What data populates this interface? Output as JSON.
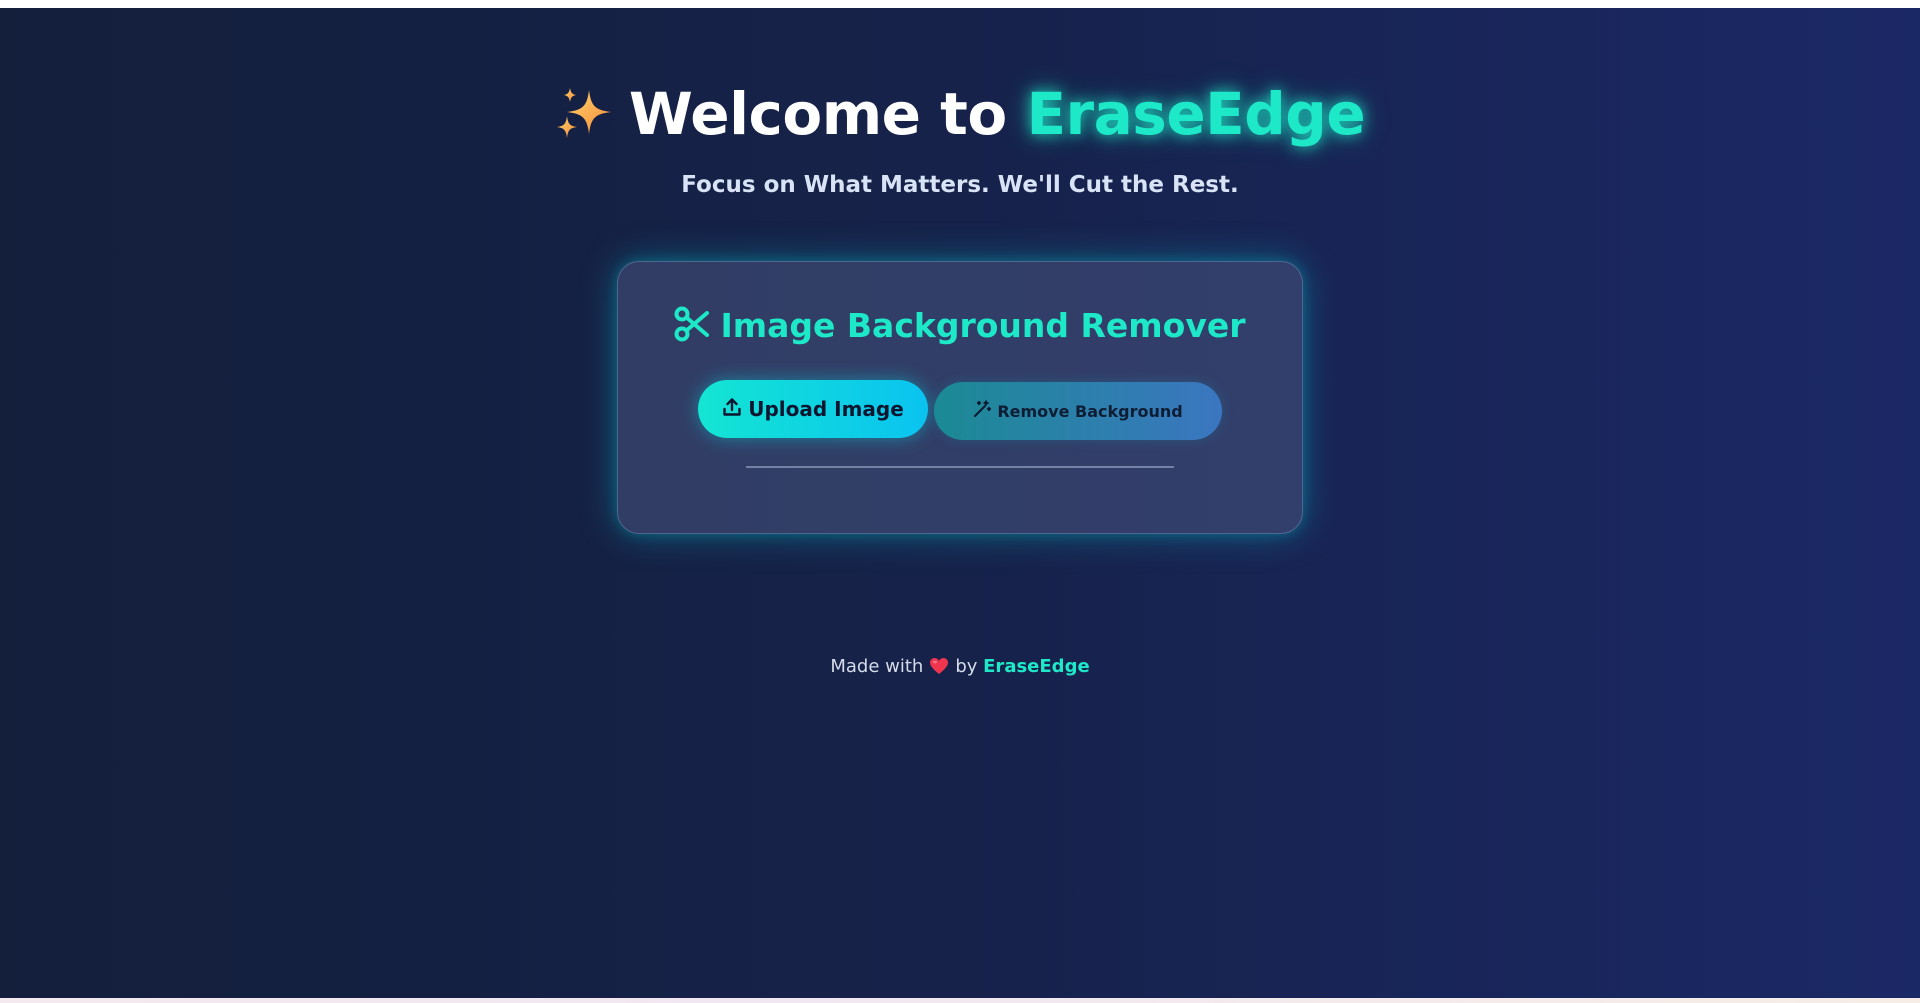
{
  "hero": {
    "title_prefix": "Welcome to",
    "brand": "EraseEdge",
    "subtitle": "Focus on What Matters. We'll Cut the Rest.",
    "icon": "sparkles-icon"
  },
  "card": {
    "title": "Image Background Remover",
    "title_icon": "scissors-icon",
    "upload_label": "Upload Image",
    "upload_icon": "upload-icon",
    "remove_label": "Remove Background",
    "remove_icon": "magic-wand-icon"
  },
  "footer": {
    "made_with": "Made with",
    "by": "by",
    "brand": "EraseEdge",
    "icon": "heart-icon"
  },
  "colors": {
    "accent": "#1de9c8",
    "background_start": "#131f3b",
    "background_end": "#1b2866",
    "heart": "#f0354f"
  }
}
